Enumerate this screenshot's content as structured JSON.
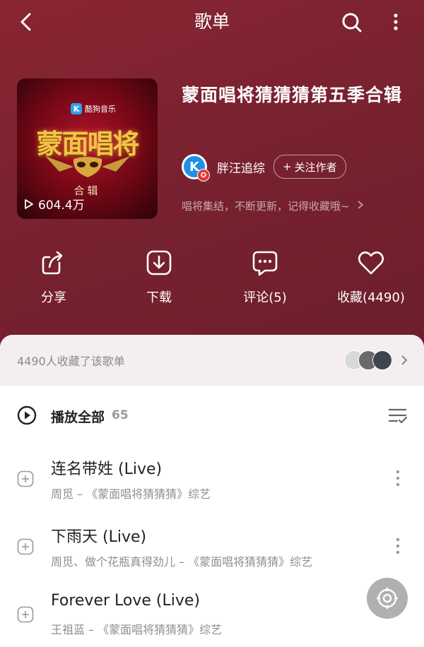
{
  "topbar": {
    "title": "歌单",
    "icons": [
      "back-arrow-icon",
      "search-icon",
      "more-vertical-icon"
    ]
  },
  "playlist": {
    "cover": {
      "brand": "酷狗音乐",
      "brand_letter": "K",
      "show_title": "蒙面唱将",
      "tag": "合辑",
      "play_count": "604.4万"
    },
    "title": "蒙面唱将猜猜猜第五季合辑",
    "author": {
      "avatar_letter": "K",
      "name": "胖汪追综",
      "follow_label": "关注作者"
    },
    "description": "唱将集结，不断更新，记得收藏哦~"
  },
  "actions": [
    {
      "label": "分享",
      "icon": "share-icon"
    },
    {
      "label": "下载",
      "icon": "download-icon"
    },
    {
      "label": "评论(5)",
      "icon": "comment-icon"
    },
    {
      "label": "收藏(4490)",
      "icon": "heart-icon"
    }
  ],
  "collectors": {
    "text": "4490人收藏了该歌单"
  },
  "play_all": {
    "label": "播放全部",
    "count": "65"
  },
  "songs": [
    {
      "title": "连名带姓 (Live)",
      "subtitle": "周觅 – 《蒙面唱将猜猜猜》综艺"
    },
    {
      "title": "下雨天 (Live)",
      "subtitle": "周觅、做个花瓶真得劲儿 – 《蒙面唱将猜猜猜》综艺"
    },
    {
      "title": "Forever Love (Live)",
      "subtitle": "王祖蓝 – 《蒙面唱将猜猜猜》综艺"
    }
  ],
  "colors": {
    "header_background": "#7a2230",
    "accent_avatar": "#1f8fe8",
    "badge": "#e53838"
  }
}
